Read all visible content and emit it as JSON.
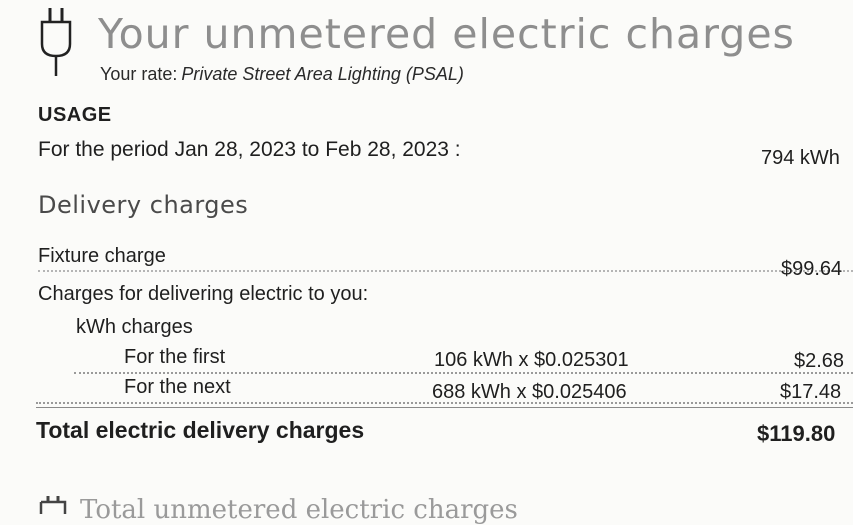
{
  "header": {
    "title": "Your unmetered electric charges",
    "rate_label": "Your rate:",
    "rate_value": "Private Street Area Lighting (PSAL)"
  },
  "usage": {
    "heading": "USAGE",
    "period_text": "For the period Jan 28, 2023 to Feb 28, 2023 :",
    "kwh": "794 kWh"
  },
  "delivery": {
    "heading": "Delivery charges",
    "fixture_label": "Fixture charge",
    "fixture_amount": "$99.64",
    "delivering_label": "Charges for delivering electric to you:",
    "kwh_charges_label": "kWh charges",
    "tiers": [
      {
        "label": "For the first",
        "calc": "106 kWh x $0.025301",
        "amount": "$2.68"
      },
      {
        "label": "For the next",
        "calc": "688 kWh x $0.025406",
        "amount": "$17.48"
      }
    ],
    "total_label": "Total electric delivery charges",
    "total_amount": "$119.80"
  },
  "footer": {
    "partial_text": "Total unmetered electric charges"
  },
  "colors": {
    "title_gray": "#8e8e8e",
    "text": "#1f1f1f"
  },
  "icons": [
    "plug-icon"
  ]
}
